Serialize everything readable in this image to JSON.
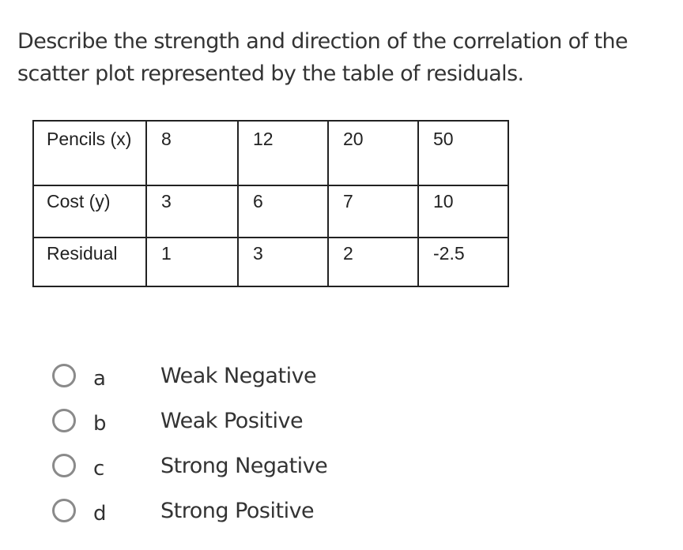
{
  "question": "Describe the strength and direction of the correlation of the scatter plot represented by the table of residuals.",
  "table": {
    "rows": [
      {
        "label": "Pencils (x)",
        "values": [
          "8",
          "12",
          "20",
          "50"
        ]
      },
      {
        "label": "Cost (y)",
        "values": [
          "3",
          "6",
          "7",
          "10"
        ]
      },
      {
        "label": "Residual",
        "values": [
          "1",
          "3",
          "2",
          "-2.5"
        ]
      }
    ]
  },
  "options": [
    {
      "letter": "a",
      "text": "Weak Negative"
    },
    {
      "letter": "b",
      "text": "Weak Positive"
    },
    {
      "letter": "c",
      "text": "Strong Negative"
    },
    {
      "letter": "d",
      "text": "Strong Positive"
    }
  ]
}
